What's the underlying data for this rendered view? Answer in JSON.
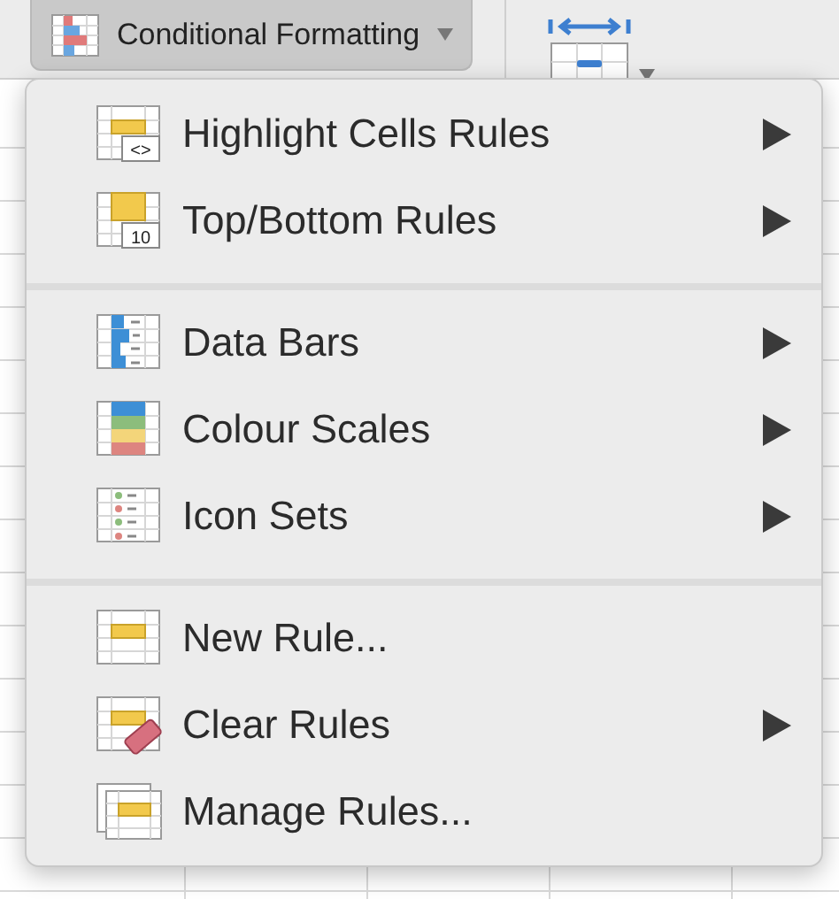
{
  "toolbar": {
    "conditional_formatting": {
      "label": "Conditional Formatting",
      "expanded": true
    }
  },
  "menu": {
    "groups": [
      {
        "items": [
          {
            "label": "Highlight Cells Rules",
            "kind": "highlight",
            "icon_text": "<>",
            "submenu": true
          },
          {
            "label": "Top/Bottom Rules",
            "kind": "topbottom",
            "icon_text": "10",
            "submenu": true
          }
        ]
      },
      {
        "items": [
          {
            "label": "Data Bars",
            "kind": "databars",
            "submenu": true
          },
          {
            "label": "Colour Scales",
            "kind": "colourscales",
            "submenu": true
          },
          {
            "label": "Icon Sets",
            "kind": "iconsets",
            "submenu": true
          }
        ]
      },
      {
        "items": [
          {
            "label": "New Rule...",
            "kind": "newrule",
            "submenu": false
          },
          {
            "label": "Clear Rules",
            "kind": "clearrules",
            "submenu": true
          },
          {
            "label": "Manage Rules...",
            "kind": "managerules",
            "submenu": false
          }
        ]
      }
    ]
  }
}
